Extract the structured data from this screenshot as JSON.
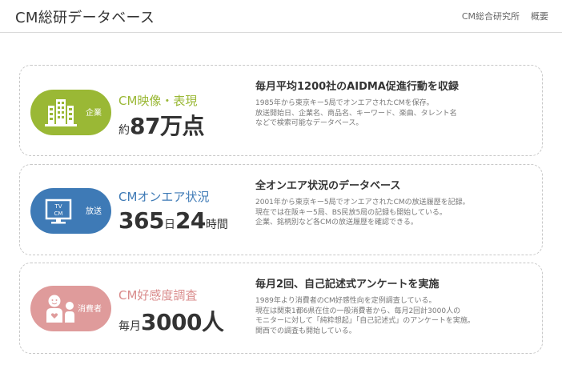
{
  "header": {
    "title": "CM総研データベース",
    "nav": [
      "CM総合研究所",
      "概要"
    ]
  },
  "cards": [
    {
      "badge_label": "企業",
      "icon": "building-icon",
      "category": "CM映像・表現",
      "stat_prefix": "約",
      "stat_number": "87万点",
      "heading": "毎月平均1200社のAIDMA促進行動を収録",
      "lines": [
        "1985年から東京キー5局でオンエアされたCMを保存。",
        "放送開始日、企業名、商品名、キーワード、楽曲、タレント名",
        "などで検索可能なデータベース。"
      ],
      "color": "#9ab835"
    },
    {
      "badge_label": "放送",
      "icon": "tv-icon",
      "icon_text_top": "TV",
      "icon_text_bottom": "CM",
      "category": "CMオンエア状況",
      "stat_num1": "365",
      "stat_unit1": "日",
      "stat_num2": "24",
      "stat_unit2": "時間",
      "heading": "全オンエア状況のデータベース",
      "lines": [
        "2001年から東京キー5局でオンエアされたCMの放送履歴を記録。",
        "現在では在阪キー5局、BS民放5局の記録も開始している。",
        "企業、銘柄別など各CMの放送履歴を確認できる。"
      ],
      "color": "#3e7ab6"
    },
    {
      "badge_label": "消費者",
      "icon": "consumer-icon",
      "category": "CM好感度調査",
      "stat_prefix": "毎月",
      "stat_number": "3000人",
      "heading": "毎月2回、自己記述式アンケートを実施",
      "lines": [
        "1989年より消費者のCM好感性向を定例調査している。",
        "現在は関東1都6県在住の一般消費者から、毎月2回計3000人の",
        "モニターに対して「純粋想起」「自己記述式」のアンケートを実施。",
        "関西での調査も開始している。"
      ],
      "color": "#df9b9b"
    }
  ]
}
